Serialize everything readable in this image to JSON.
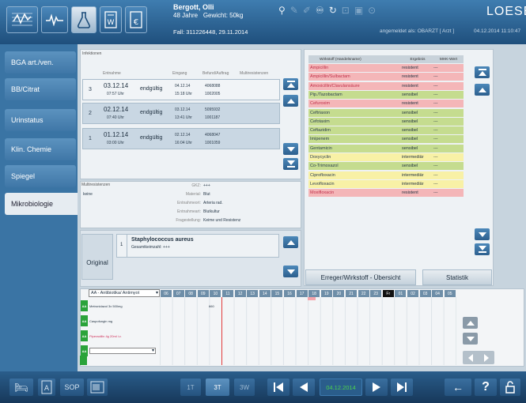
{
  "patient": {
    "name": "Bergott, Olli",
    "age": "48 Jahre",
    "weight": "Gewicht: 50kg",
    "fall": "Fall: 311226448, 29.11.2014"
  },
  "session": {
    "logged_in": "angemeldet als: OBARZT [ Arzt ]",
    "datetime": "04.12.2014  11:10:47"
  },
  "logo": "LOESER",
  "sidebar": {
    "items": [
      {
        "label": "BGA art./ven."
      },
      {
        "label": "BB/Citrat"
      },
      {
        "label": "Urinstatus"
      },
      {
        "label": "Klin. Chemie"
      },
      {
        "label": "Spiegel"
      },
      {
        "label": "Mikrobiologie"
      }
    ]
  },
  "infektionen": {
    "title": "Infektionen",
    "headers": [
      "Entnahme",
      "Eingang",
      "Befund/Auftrag",
      "Multiresistenzen"
    ],
    "rows": [
      {
        "num": "3",
        "date": "03.12.14",
        "time": "07:57 Uhr",
        "status": "endgültig",
        "eingang_date": "04.12.14",
        "eingang_time": "15:18 Uhr",
        "befund": "4068088",
        "auftrag": "1002005"
      },
      {
        "num": "2",
        "date": "02.12.14",
        "time": "07:40 Uhr",
        "status": "endgültig",
        "eingang_date": "03.12.14",
        "eingang_time": "13:41 Uhr",
        "befund": "5095932",
        "auftrag": "1001187"
      },
      {
        "num": "1",
        "date": "01.12.14",
        "time": "03:00 Uhr",
        "status": "endgültig",
        "eingang_date": "02.12.14",
        "eingang_time": "16:04 Uhr",
        "befund": "4068047",
        "auftrag": "1001059"
      }
    ]
  },
  "multiresistenzen": {
    "title": "Multiresistenzen",
    "value": "keine",
    "details": [
      {
        "label": "GKZ:",
        "value": "+++"
      },
      {
        "label": "Material:",
        "value": "Blut"
      },
      {
        "label": "Entnahmeort:",
        "value": "Arteria rad."
      },
      {
        "label": "Entnahmeart:",
        "value": "Blutkultur"
      },
      {
        "label": "Fragestellung:",
        "value": "Keime und Resistenz"
      }
    ]
  },
  "organism": {
    "original_label": "Original",
    "num": "1",
    "name": "Staphylococcus aureus",
    "count": "Gesamtkeimzahl: +++"
  },
  "wirkstoff_table": {
    "headers": [
      "Wirkstoff (Handelsname)",
      "Ergebnis",
      "MHK-Wert"
    ],
    "colors": {
      "resistent": "#f4b6b8",
      "sensibel": "#c5dc8f",
      "intermediaer": "#f8f1a6"
    },
    "rows": [
      {
        "name": "Ampicillin",
        "result": "resistent",
        "mhk": "---",
        "cls": "resistent"
      },
      {
        "name": "Ampicillin/Sulbactam",
        "result": "resistent",
        "mhk": "---",
        "cls": "resistent"
      },
      {
        "name": "Amoxicillin/Clavulansäure",
        "result": "resistent",
        "mhk": "---",
        "cls": "resistent"
      },
      {
        "name": "Pip./Tazobactam",
        "result": "sensibel",
        "mhk": "---",
        "cls": "sensibel"
      },
      {
        "name": "Cefuroxim",
        "result": "resistent",
        "mhk": "---",
        "cls": "resistent"
      },
      {
        "name": "Ceftriaxon",
        "result": "sensibel",
        "mhk": "---",
        "cls": "sensibel"
      },
      {
        "name": "Cefotaxim",
        "result": "sensibel",
        "mhk": "---",
        "cls": "sensibel"
      },
      {
        "name": "Ceftazidim",
        "result": "sensibel",
        "mhk": "---",
        "cls": "sensibel"
      },
      {
        "name": "Imipenem",
        "result": "sensibel",
        "mhk": "---",
        "cls": "sensibel"
      },
      {
        "name": "Gentamicin",
        "result": "sensibel",
        "mhk": "---",
        "cls": "sensibel"
      },
      {
        "name": "Doxycyclin",
        "result": "intermediär",
        "mhk": "---",
        "cls": "intermediaer"
      },
      {
        "name": "Co-Trimoxazol",
        "result": "sensibel",
        "mhk": "---",
        "cls": "sensibel"
      },
      {
        "name": "Ciprofloxacin",
        "result": "intermediär",
        "mhk": "---",
        "cls": "intermediaer"
      },
      {
        "name": "Levofloxacin",
        "result": "intermediär",
        "mhk": "---",
        "cls": "intermediaer"
      },
      {
        "name": "Moxifloxacin",
        "result": "resistent",
        "mhk": "---",
        "cls": "resistent"
      }
    ]
  },
  "buttons": {
    "erreger": "Erreger/Wirkstoff - Übersicht",
    "statistik": "Statistik"
  },
  "timeline": {
    "select": "AA - Antibiotika/ Antimyot",
    "hours": [
      "06",
      "07",
      "08",
      "09",
      "10",
      "11",
      "12",
      "13",
      "14",
      "15",
      "16",
      "17",
      "18",
      "19",
      "20",
      "21",
      "22",
      "23",
      "Fr",
      "01",
      "02",
      "03",
      "04",
      "05"
    ],
    "meds": [
      {
        "tag": "AA",
        "label": "Metronidazol 3x 500mg",
        "mark": "660"
      },
      {
        "tag": "AA",
        "label": "Caspofungin mg",
        "mark": ""
      },
      {
        "tag": "AA",
        "label": "Piperacillin 4g 20ml i.v.",
        "mark": ""
      },
      {
        "tag": "AA",
        "label": "",
        "mark": ""
      }
    ]
  },
  "bottom": {
    "sop": "SOP",
    "range": [
      "1T",
      "3T",
      "3W"
    ],
    "date": "04.12.2014"
  }
}
